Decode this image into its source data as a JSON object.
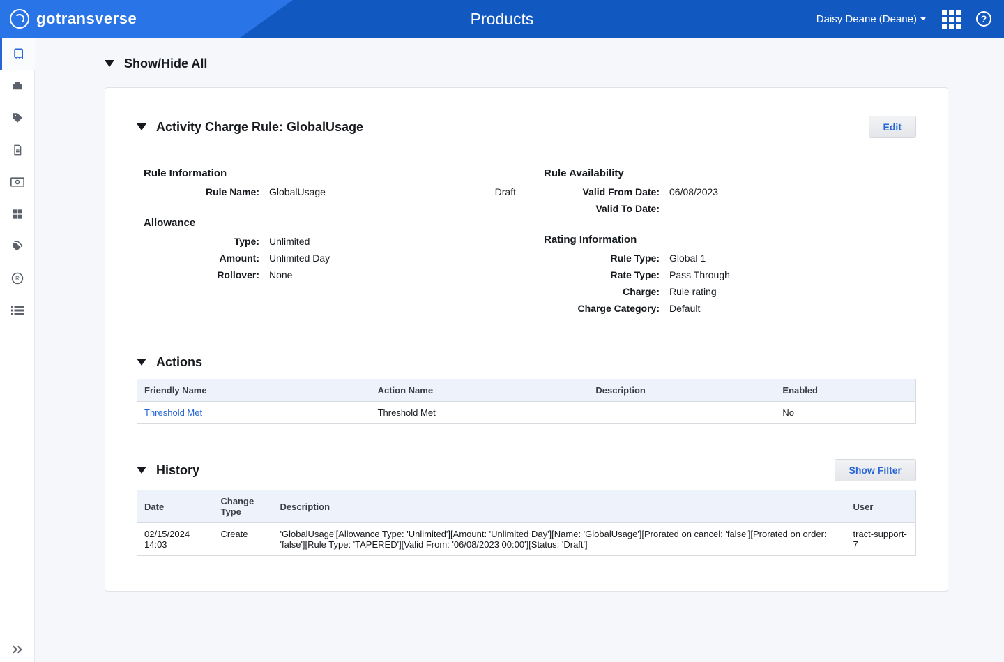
{
  "header": {
    "logo_text": "gotransverse",
    "title": "Products",
    "user_label": "Daisy Deane (Deane)",
    "help_glyph": "?"
  },
  "show_hide_label": "Show/Hide All",
  "rule_card": {
    "title": "Activity Charge Rule: GlobalUsage",
    "edit_label": "Edit",
    "rule_info_title": "Rule Information",
    "rule_name_label": "Rule Name:",
    "rule_name_value": "GlobalUsage",
    "rule_status": "Draft",
    "allowance_title": "Allowance",
    "type_label": "Type:",
    "type_value": "Unlimited",
    "amount_label": "Amount:",
    "amount_value": "Unlimited Day",
    "rollover_label": "Rollover:",
    "rollover_value": "None",
    "availability_title": "Rule Availability",
    "valid_from_label": "Valid From Date:",
    "valid_from_value": "06/08/2023",
    "valid_to_label": "Valid To Date:",
    "valid_to_value": "",
    "rating_info_title": "Rating Information",
    "rule_type_label": "Rule Type:",
    "rule_type_value": "Global 1",
    "rate_type_label": "Rate Type:",
    "rate_type_value": "Pass Through",
    "charge_label": "Charge:",
    "charge_value": "Rule rating",
    "charge_cat_label": "Charge Category:",
    "charge_cat_value": "Default"
  },
  "actions": {
    "title": "Actions",
    "cols": {
      "c1": "Friendly Name",
      "c2": "Action Name",
      "c3": "Description",
      "c4": "Enabled"
    },
    "row": {
      "friendly": "Threshold Met",
      "action": "Threshold Met",
      "desc": "",
      "enabled": "No"
    }
  },
  "history": {
    "title": "History",
    "show_filter_label": "Show Filter",
    "cols": {
      "c1": "Date",
      "c2": "Change Type",
      "c3": "Description",
      "c4": "User"
    },
    "row": {
      "date": "02/15/2024 14:03",
      "ctype": "Create",
      "desc": "'GlobalUsage'[Allowance Type: 'Unlimited'][Amount: 'Unlimited Day'][Name: 'GlobalUsage'][Prorated on cancel: 'false'][Prorated on order: 'false'][Rule Type: 'TAPERED'][Valid From: '06/08/2023 00:00'][Status: 'Draft']",
      "user": "tract-support-7"
    }
  }
}
